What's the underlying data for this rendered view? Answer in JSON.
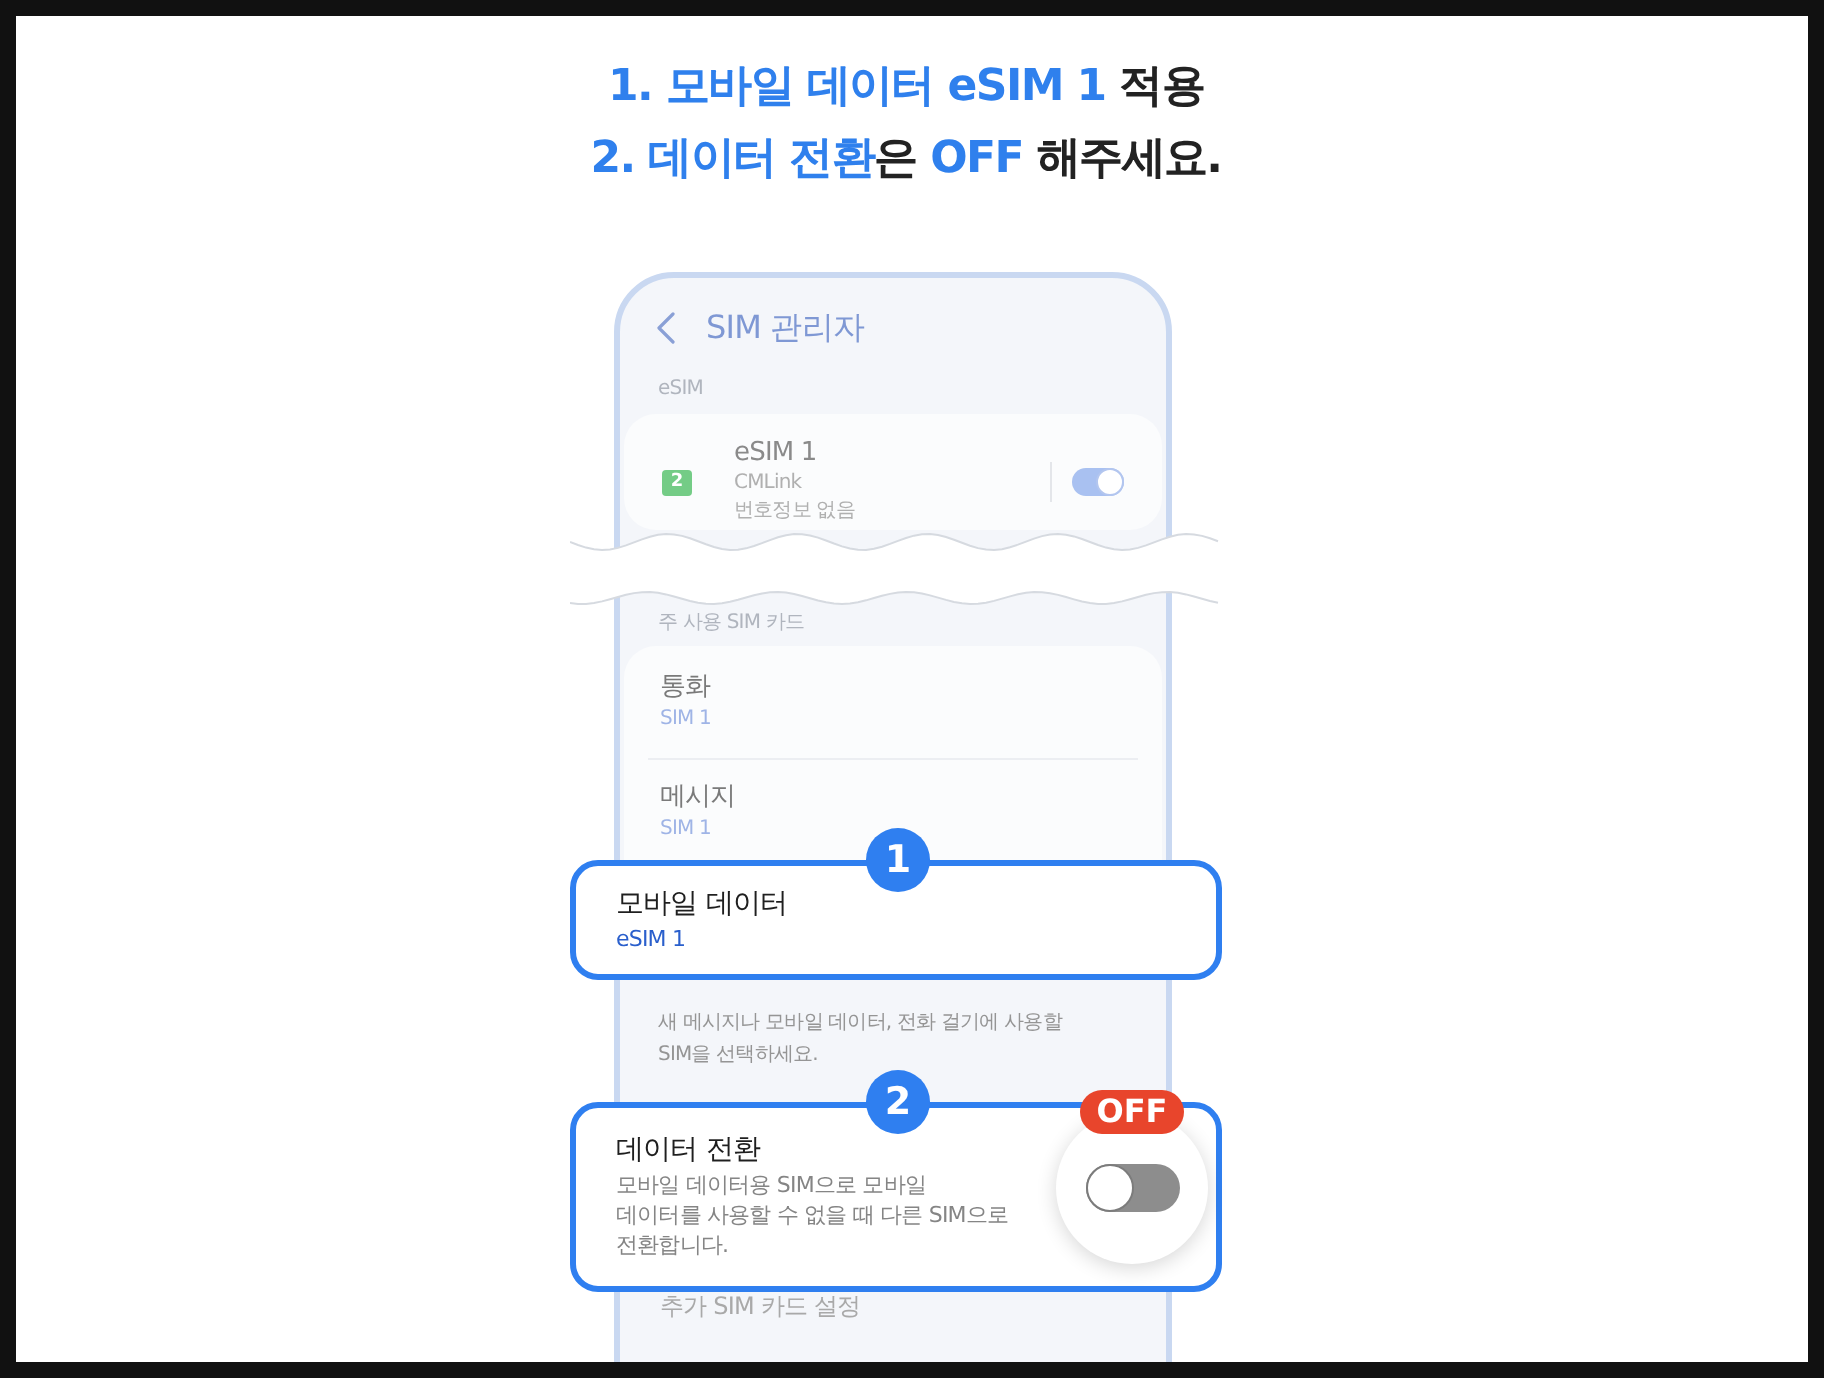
{
  "instructions": [
    {
      "segments": [
        {
          "text": "1. 모바일 데이터 eSIM 1",
          "highlight": true
        },
        {
          "text": " 적용",
          "highlight": false
        }
      ]
    },
    {
      "segments": [
        {
          "text": "2. 데이터 전환",
          "highlight": true
        },
        {
          "text": "은 ",
          "highlight": false
        },
        {
          "text": "OFF",
          "highlight": true
        },
        {
          "text": " 해주세요.",
          "highlight": false
        }
      ]
    }
  ],
  "phone": {
    "header": {
      "title": "SIM 관리자"
    },
    "esim_section": {
      "label": "eSIM",
      "sim": {
        "slot": "2",
        "name": "eSIM 1",
        "carrier": "CMLink",
        "number": "번호정보 없음",
        "on": true
      }
    },
    "primary_section": {
      "label": "주 사용 SIM 카드",
      "items": [
        {
          "title": "통화",
          "value": "SIM 1",
          "highlighted": false
        },
        {
          "title": "메시지",
          "value": "SIM 1",
          "highlighted": false
        },
        {
          "title": "모바일 데이터",
          "value": "eSIM 1",
          "highlighted": true,
          "step": "1"
        }
      ],
      "note": "새 메시지나 모바일 데이터, 전화 걸기에 사용할\nSIM을 선택하세요."
    },
    "data_switch": {
      "title": "데이터 전환",
      "description": "모바일 데이터용 SIM으로 모바일\n데이터를 사용할 수 없을 때 다른 SIM으로\n전환합니다.",
      "on": false,
      "highlighted": true,
      "step": "2",
      "state_badge": "OFF"
    },
    "next_section": {
      "label": "추가 SIM 카드 설정"
    }
  }
}
